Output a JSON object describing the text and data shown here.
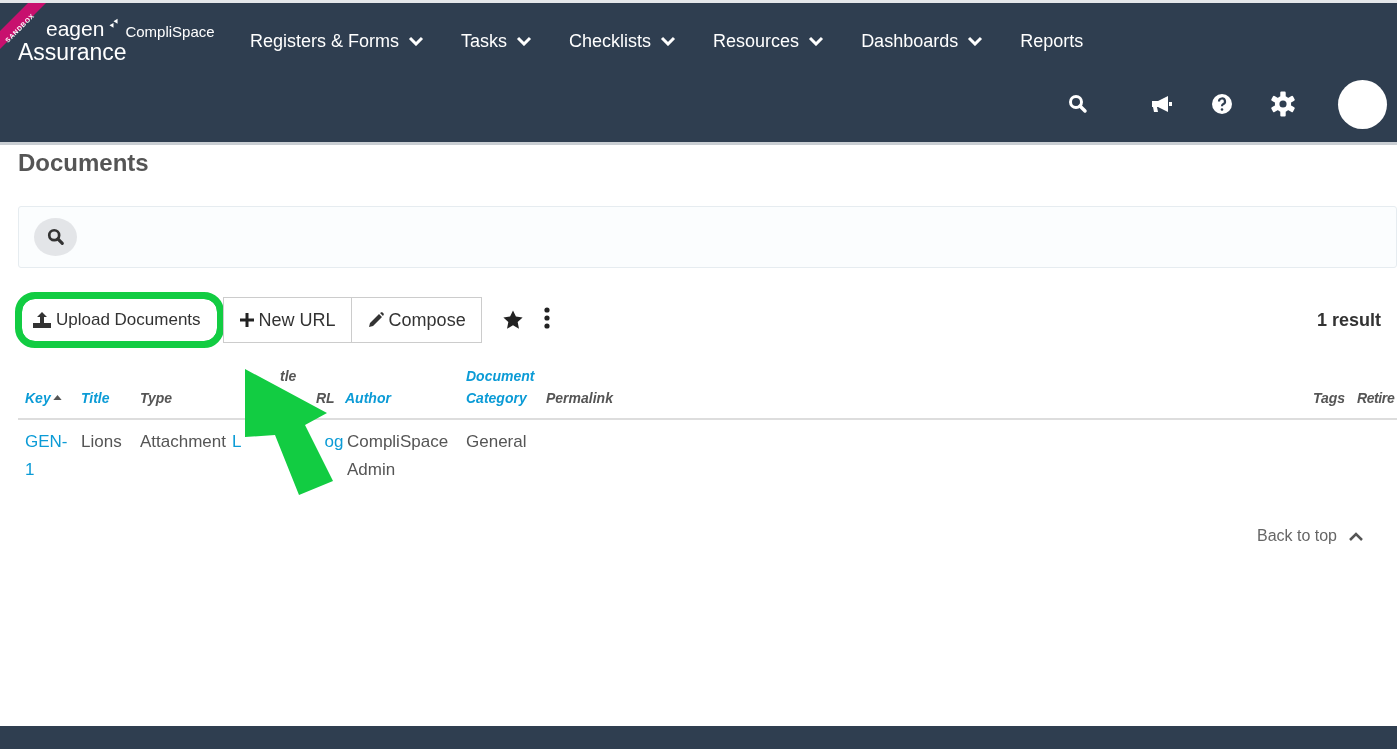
{
  "header": {
    "ribbon": "SANDBOX",
    "logo_brand": "eagen",
    "logo_product": "CompliSpace",
    "logo_subtitle": "Assurance",
    "nav": [
      {
        "label": "Registers & Forms",
        "has_menu": true
      },
      {
        "label": "Tasks",
        "has_menu": true
      },
      {
        "label": "Checklists",
        "has_menu": true
      },
      {
        "label": "Resources",
        "has_menu": true
      },
      {
        "label": "Dashboards",
        "has_menu": true
      },
      {
        "label": "Reports",
        "has_menu": false
      }
    ]
  },
  "page": {
    "title": "Documents"
  },
  "toolbar": {
    "buttons": [
      {
        "label": "Upload Documents",
        "kind": "upload",
        "highlighted": true
      },
      {
        "label": "New URL",
        "kind": "add",
        "highlighted": false
      },
      {
        "label": "Compose",
        "kind": "edit",
        "highlighted": false
      }
    ],
    "result_count": "1 result"
  },
  "table": {
    "columns": [
      {
        "lines": [
          "Key"
        ],
        "kind": "link",
        "sorted": true
      },
      {
        "lines": [
          "Title"
        ],
        "kind": "link",
        "sorted": false
      },
      {
        "lines": [
          "Type"
        ],
        "kind": "plain",
        "sorted": false
      },
      {
        "lines": [
          "tle",
          "RL"
        ],
        "kind": "plain",
        "sorted": false
      },
      {
        "lines": [
          "Author"
        ],
        "kind": "link",
        "sorted": false
      },
      {
        "lines": [
          "Document",
          "Category"
        ],
        "kind": "link",
        "sorted": false
      },
      {
        "lines": [
          "Permalink"
        ],
        "kind": "plain",
        "sorted": false
      },
      {
        "lines": [
          "Tags"
        ],
        "kind": "plain",
        "sorted": false
      },
      {
        "lines": [
          "Retire"
        ],
        "kind": "plain",
        "sorted": false
      }
    ],
    "rows": [
      {
        "cells": [
          {
            "parts": [
              "GEN-1"
            ],
            "kind": "link"
          },
          {
            "parts": [
              "Lions"
            ],
            "kind": "plain"
          },
          {
            "parts": [
              "Attachment"
            ],
            "kind": "plain"
          },
          {
            "parts": [
              "L",
              "og"
            ],
            "kind": "link"
          },
          {
            "parts": [
              "CompliSpace Admin"
            ],
            "kind": "plain"
          },
          {
            "parts": [
              "General"
            ],
            "kind": "plain"
          }
        ]
      }
    ]
  },
  "back_to_top": "Back to top"
}
